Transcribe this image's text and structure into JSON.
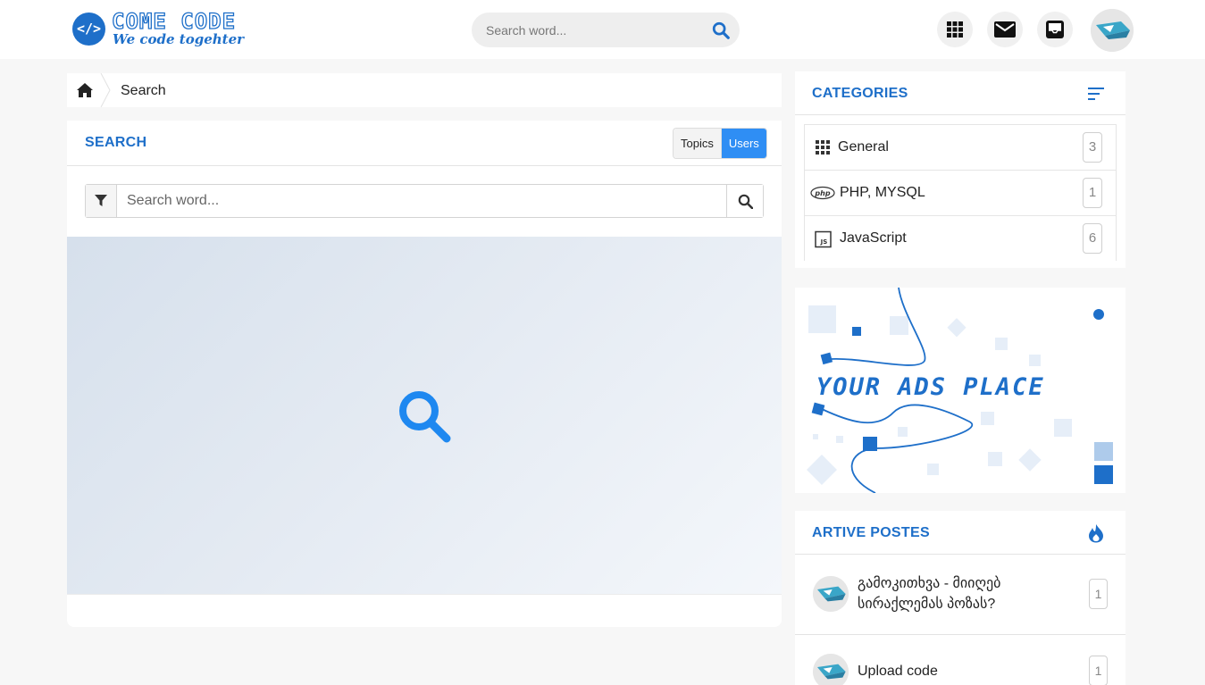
{
  "brand": {
    "logo_mark": "</>",
    "name": "COME CODE",
    "tagline": "We code togehter"
  },
  "header": {
    "search_placeholder": "Search word...",
    "icons": [
      "grid-icon",
      "mail-icon",
      "inbox-icon",
      "user-avatar"
    ]
  },
  "breadcrumb": {
    "current": "Search"
  },
  "search": {
    "title": "SEARCH",
    "tabs": [
      "Topics",
      "Users"
    ],
    "active_tab": "Users",
    "input_placeholder": "Search word..."
  },
  "categories": {
    "title": "CATEGORIES",
    "items": [
      {
        "icon": "grid-icon",
        "name": "General",
        "count": "3"
      },
      {
        "icon": "php-icon",
        "name": "PHP, MYSQL",
        "count": "1"
      },
      {
        "icon": "js-icon",
        "name": "JavaScript",
        "count": "6"
      }
    ]
  },
  "ad": {
    "text": "YOUR ADS PLACE"
  },
  "active_posts": {
    "title": "ARTIVE POSTES",
    "items": [
      {
        "title": "გამოკითხვა - მიიღებ სირაქლემას პოზას?",
        "count": "1"
      },
      {
        "title": "Upload code",
        "count": "1"
      }
    ]
  },
  "colors": {
    "accent": "#1e6fc9",
    "toggle_active": "#2f8ef4",
    "page_bg": "#f7f7f7"
  }
}
